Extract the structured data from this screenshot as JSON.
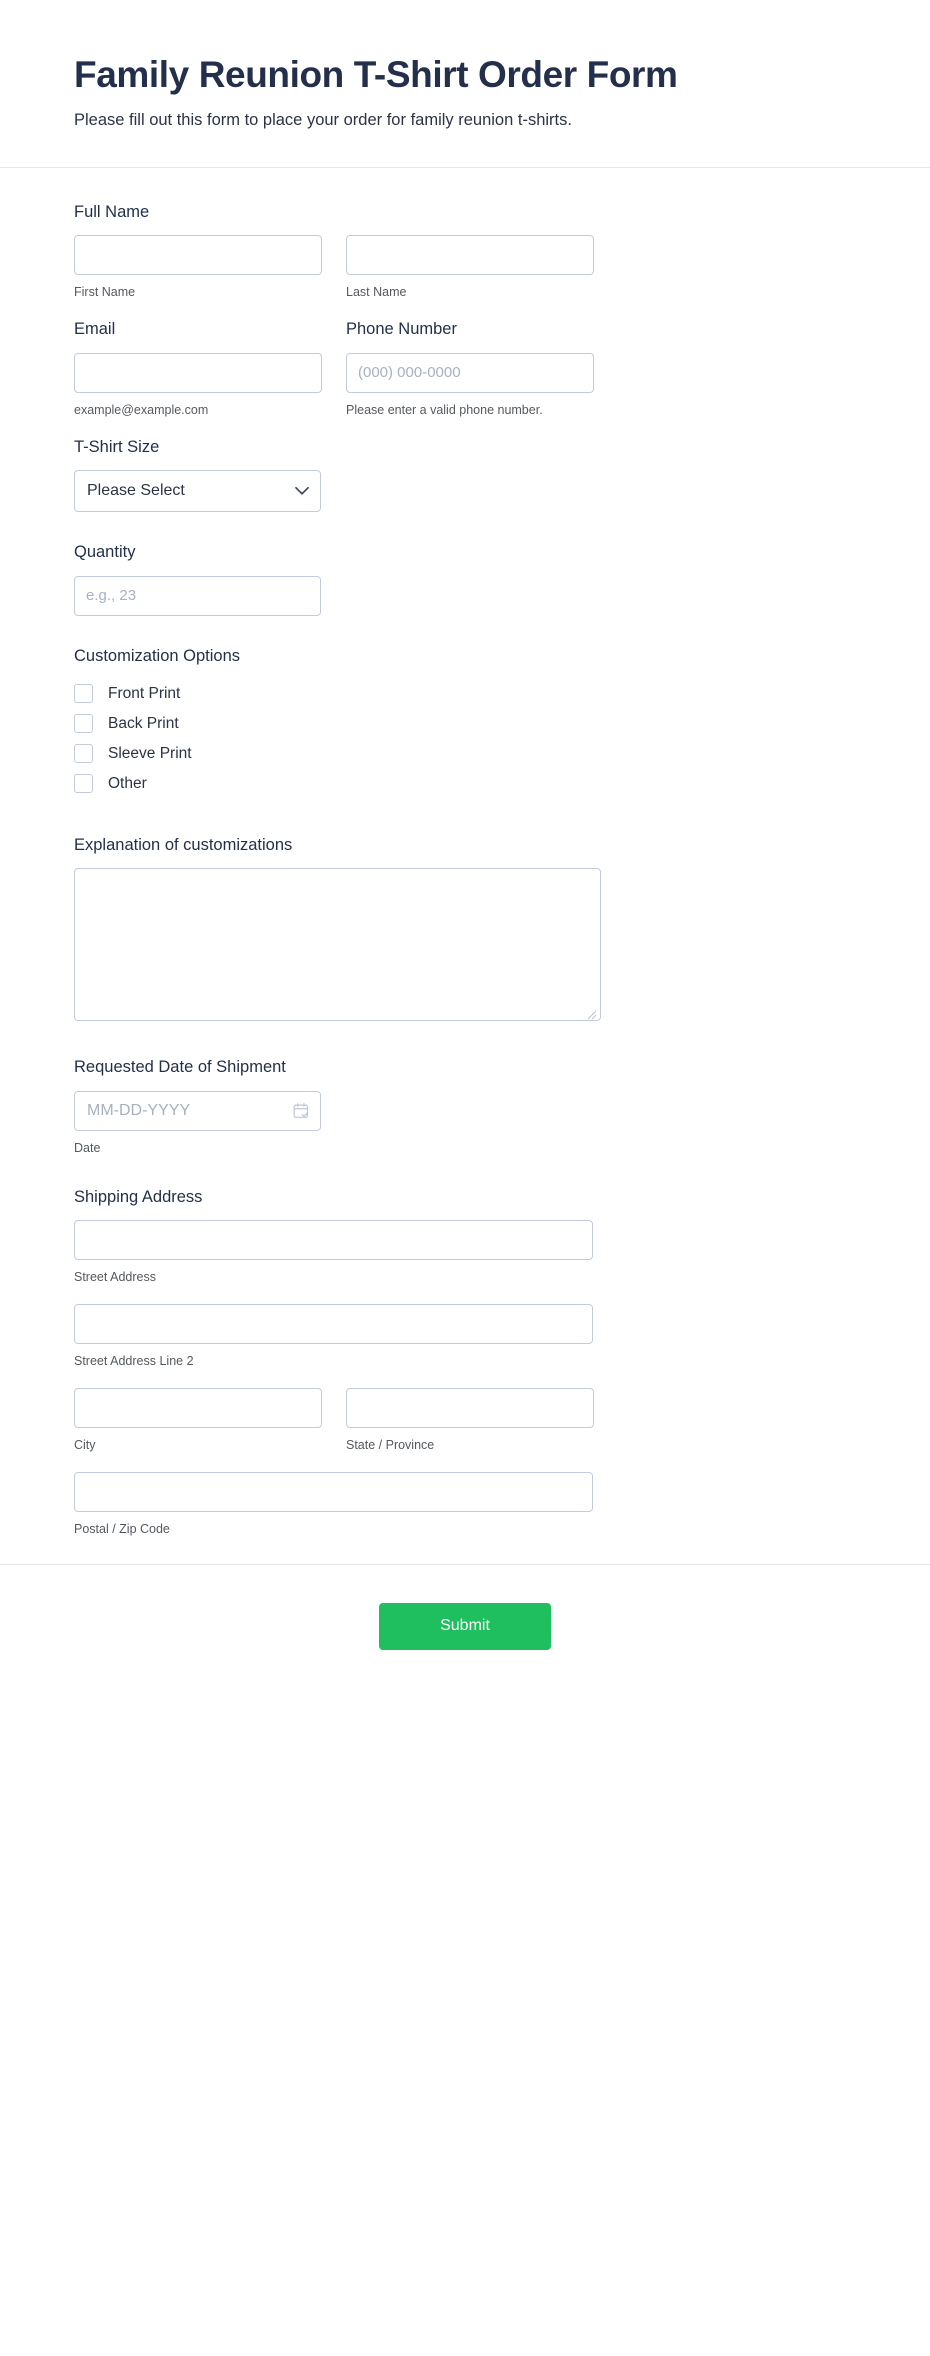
{
  "header": {
    "title": "Family Reunion T-Shirt Order Form",
    "subtitle": "Please fill out this form to place your order for family reunion t-shirts."
  },
  "fields": {
    "full_name": {
      "label": "Full Name",
      "first": {
        "value": "",
        "placeholder": "",
        "sub_label": "First Name"
      },
      "last": {
        "value": "",
        "placeholder": "",
        "sub_label": "Last Name"
      }
    },
    "email": {
      "label": "Email",
      "value": "",
      "placeholder": "",
      "sub_label": "example@example.com"
    },
    "phone": {
      "label": "Phone Number",
      "value": "",
      "placeholder": "(000) 000-0000",
      "sub_label": "Please enter a valid phone number."
    },
    "tshirt_size": {
      "label": "T-Shirt Size",
      "selected": "Please Select",
      "options": [
        "Please Select"
      ],
      "chevron_icon": "chevron-down-icon"
    },
    "quantity": {
      "label": "Quantity",
      "value": "",
      "placeholder": "e.g., 23"
    },
    "customization": {
      "label": "Customization Options",
      "options": [
        {
          "label": "Front Print",
          "checked": false
        },
        {
          "label": "Back Print",
          "checked": false
        },
        {
          "label": "Sleeve Print",
          "checked": false
        },
        {
          "label": "Other",
          "checked": false
        }
      ]
    },
    "explanation": {
      "label": "Explanation of customizations",
      "value": "",
      "placeholder": ""
    },
    "shipment_date": {
      "label": "Requested Date of Shipment",
      "value": "",
      "placeholder": "MM-DD-YYYY",
      "sub_label": "Date",
      "icon": "calendar-icon"
    },
    "shipping_address": {
      "label": "Shipping Address",
      "street": {
        "value": "",
        "placeholder": "",
        "sub_label": "Street Address"
      },
      "street2": {
        "value": "",
        "placeholder": "",
        "sub_label": "Street Address Line 2"
      },
      "city": {
        "value": "",
        "placeholder": "",
        "sub_label": "City"
      },
      "state": {
        "value": "",
        "placeholder": "",
        "sub_label": "State / Province"
      },
      "postal": {
        "value": "",
        "placeholder": "",
        "sub_label": "Postal / Zip Code"
      }
    }
  },
  "footer": {
    "submit_label": "Submit"
  },
  "colors": {
    "submit_green": "#1fbf5f",
    "title_navy": "#24304b",
    "border_gray": "#c3cad9",
    "placeholder_gray": "#a6b1c2",
    "sublabel_gray": "#54595f"
  }
}
